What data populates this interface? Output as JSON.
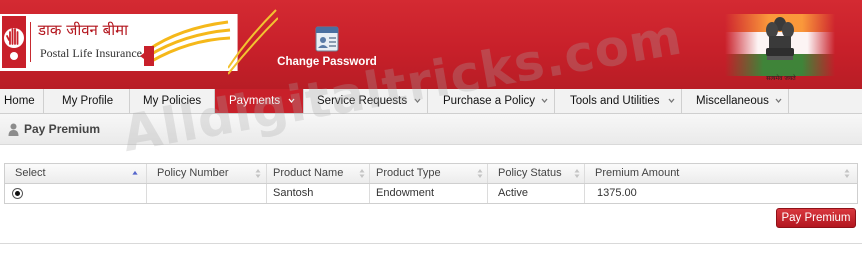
{
  "header": {
    "logo_hindi": "डाक जीवन बीमा",
    "logo_english": "Postal Life Insurance",
    "change_password_label": "Change Password",
    "emblem_caption": "सत्यमेव जयते"
  },
  "nav": {
    "items": [
      {
        "label": "Home",
        "dropdown": false,
        "active": false
      },
      {
        "label": "My Profile",
        "dropdown": false,
        "active": false
      },
      {
        "label": "My Policies",
        "dropdown": false,
        "active": false
      },
      {
        "label": "Payments",
        "dropdown": true,
        "active": true
      },
      {
        "label": "Service Requests",
        "dropdown": true,
        "active": false
      },
      {
        "label": "Purchase a Policy",
        "dropdown": true,
        "active": false
      },
      {
        "label": "Tools and Utilities",
        "dropdown": true,
        "active": false
      },
      {
        "label": "Miscellaneous",
        "dropdown": true,
        "active": false
      }
    ]
  },
  "page": {
    "title": "Pay Premium",
    "watermark": "Alldigitaltricks.com"
  },
  "table": {
    "columns": [
      "Select",
      "Policy Number",
      "Product Name",
      "Product Type",
      "Policy Status",
      "Premium Amount"
    ],
    "sorted_column": "Select",
    "rows": [
      {
        "selected": true,
        "policy_number": "",
        "product_name": "Santosh",
        "product_type": "Endowment",
        "policy_status": "Active",
        "premium_amount": "1375.00"
      }
    ]
  },
  "actions": {
    "pay_premium_label": "Pay Premium"
  },
  "colors": {
    "brand_red": "#c8202a",
    "nav_bg": "#f2f2f2",
    "button_red": "#c0222b"
  },
  "icons": [
    "hand-emblem-icon",
    "post-horn-icon",
    "change-password-icon",
    "state-emblem-icon",
    "user-icon",
    "sort-icon",
    "chevron-down-icon"
  ]
}
